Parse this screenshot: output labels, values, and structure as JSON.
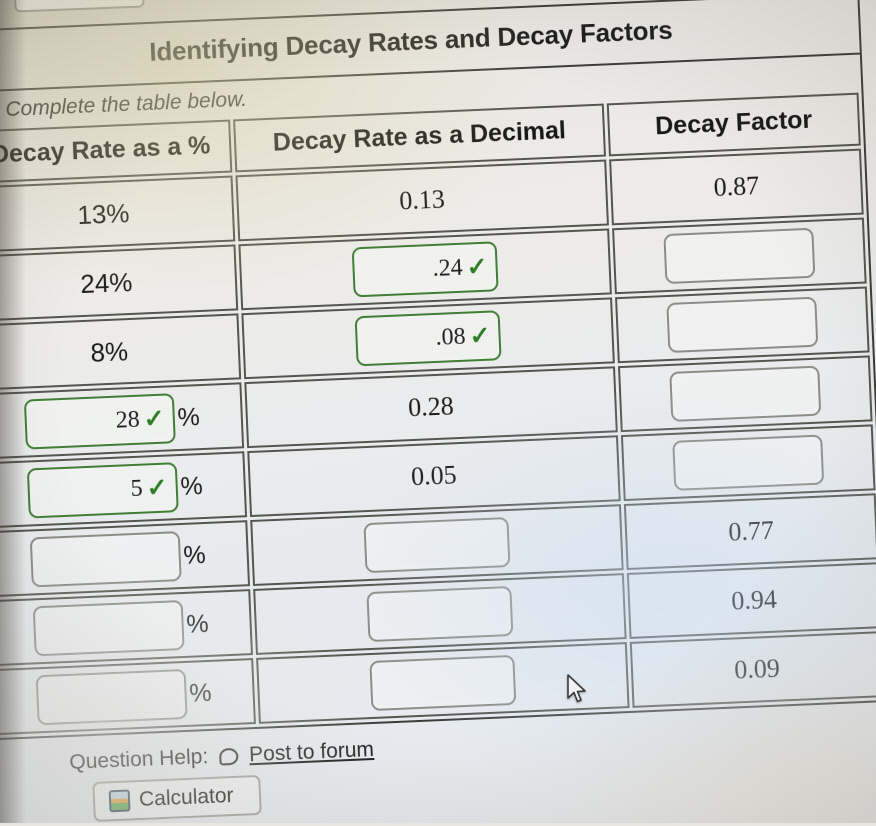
{
  "worksheet": {
    "title": "Identifying Decay Rates and Decay Factors",
    "instruction": "Complete the table below.",
    "columns": [
      "Decay Rate as a %",
      "Decay Rate as a Decimal",
      "Decay Factor"
    ],
    "percent_suffix": "%",
    "check_glyph": "✓",
    "rows": [
      {
        "percent": {
          "type": "static",
          "value": "13%"
        },
        "decimal": {
          "type": "static",
          "value": "0.13"
        },
        "factor": {
          "type": "static",
          "value": "0.87"
        }
      },
      {
        "percent": {
          "type": "static",
          "value": "24%"
        },
        "decimal": {
          "type": "input",
          "value": ".24",
          "state": "correct"
        },
        "factor": {
          "type": "input",
          "value": "",
          "state": "empty"
        }
      },
      {
        "percent": {
          "type": "static",
          "value": "8%"
        },
        "decimal": {
          "type": "input",
          "value": ".08",
          "state": "correct"
        },
        "factor": {
          "type": "input",
          "value": "",
          "state": "empty"
        }
      },
      {
        "percent": {
          "type": "input",
          "value": "28",
          "state": "correct"
        },
        "decimal": {
          "type": "static",
          "value": "0.28"
        },
        "factor": {
          "type": "input",
          "value": "",
          "state": "empty"
        }
      },
      {
        "percent": {
          "type": "input",
          "value": "5",
          "state": "correct"
        },
        "decimal": {
          "type": "static",
          "value": "0.05"
        },
        "factor": {
          "type": "input",
          "value": "",
          "state": "empty"
        }
      },
      {
        "percent": {
          "type": "input",
          "value": "",
          "state": "empty"
        },
        "decimal": {
          "type": "input",
          "value": "",
          "state": "empty"
        },
        "factor": {
          "type": "static",
          "value": "0.77"
        }
      },
      {
        "percent": {
          "type": "input",
          "value": "",
          "state": "empty"
        },
        "decimal": {
          "type": "input",
          "value": "",
          "state": "empty"
        },
        "factor": {
          "type": "static",
          "value": "0.94"
        }
      },
      {
        "percent": {
          "type": "input",
          "value": "",
          "state": "empty"
        },
        "decimal": {
          "type": "input",
          "value": "",
          "state": "empty"
        },
        "factor": {
          "type": "static",
          "value": "0.09"
        }
      }
    ]
  },
  "footer": {
    "help_label": "Question Help:",
    "forum_link": "Post to forum",
    "calculator_label": "Calculator"
  },
  "colors": {
    "correct_border": "#3f7d34",
    "check_mark": "#2e7d26",
    "empty_border": "#8d8d88",
    "table_border": "#55554f",
    "text": "#1a1a18"
  }
}
